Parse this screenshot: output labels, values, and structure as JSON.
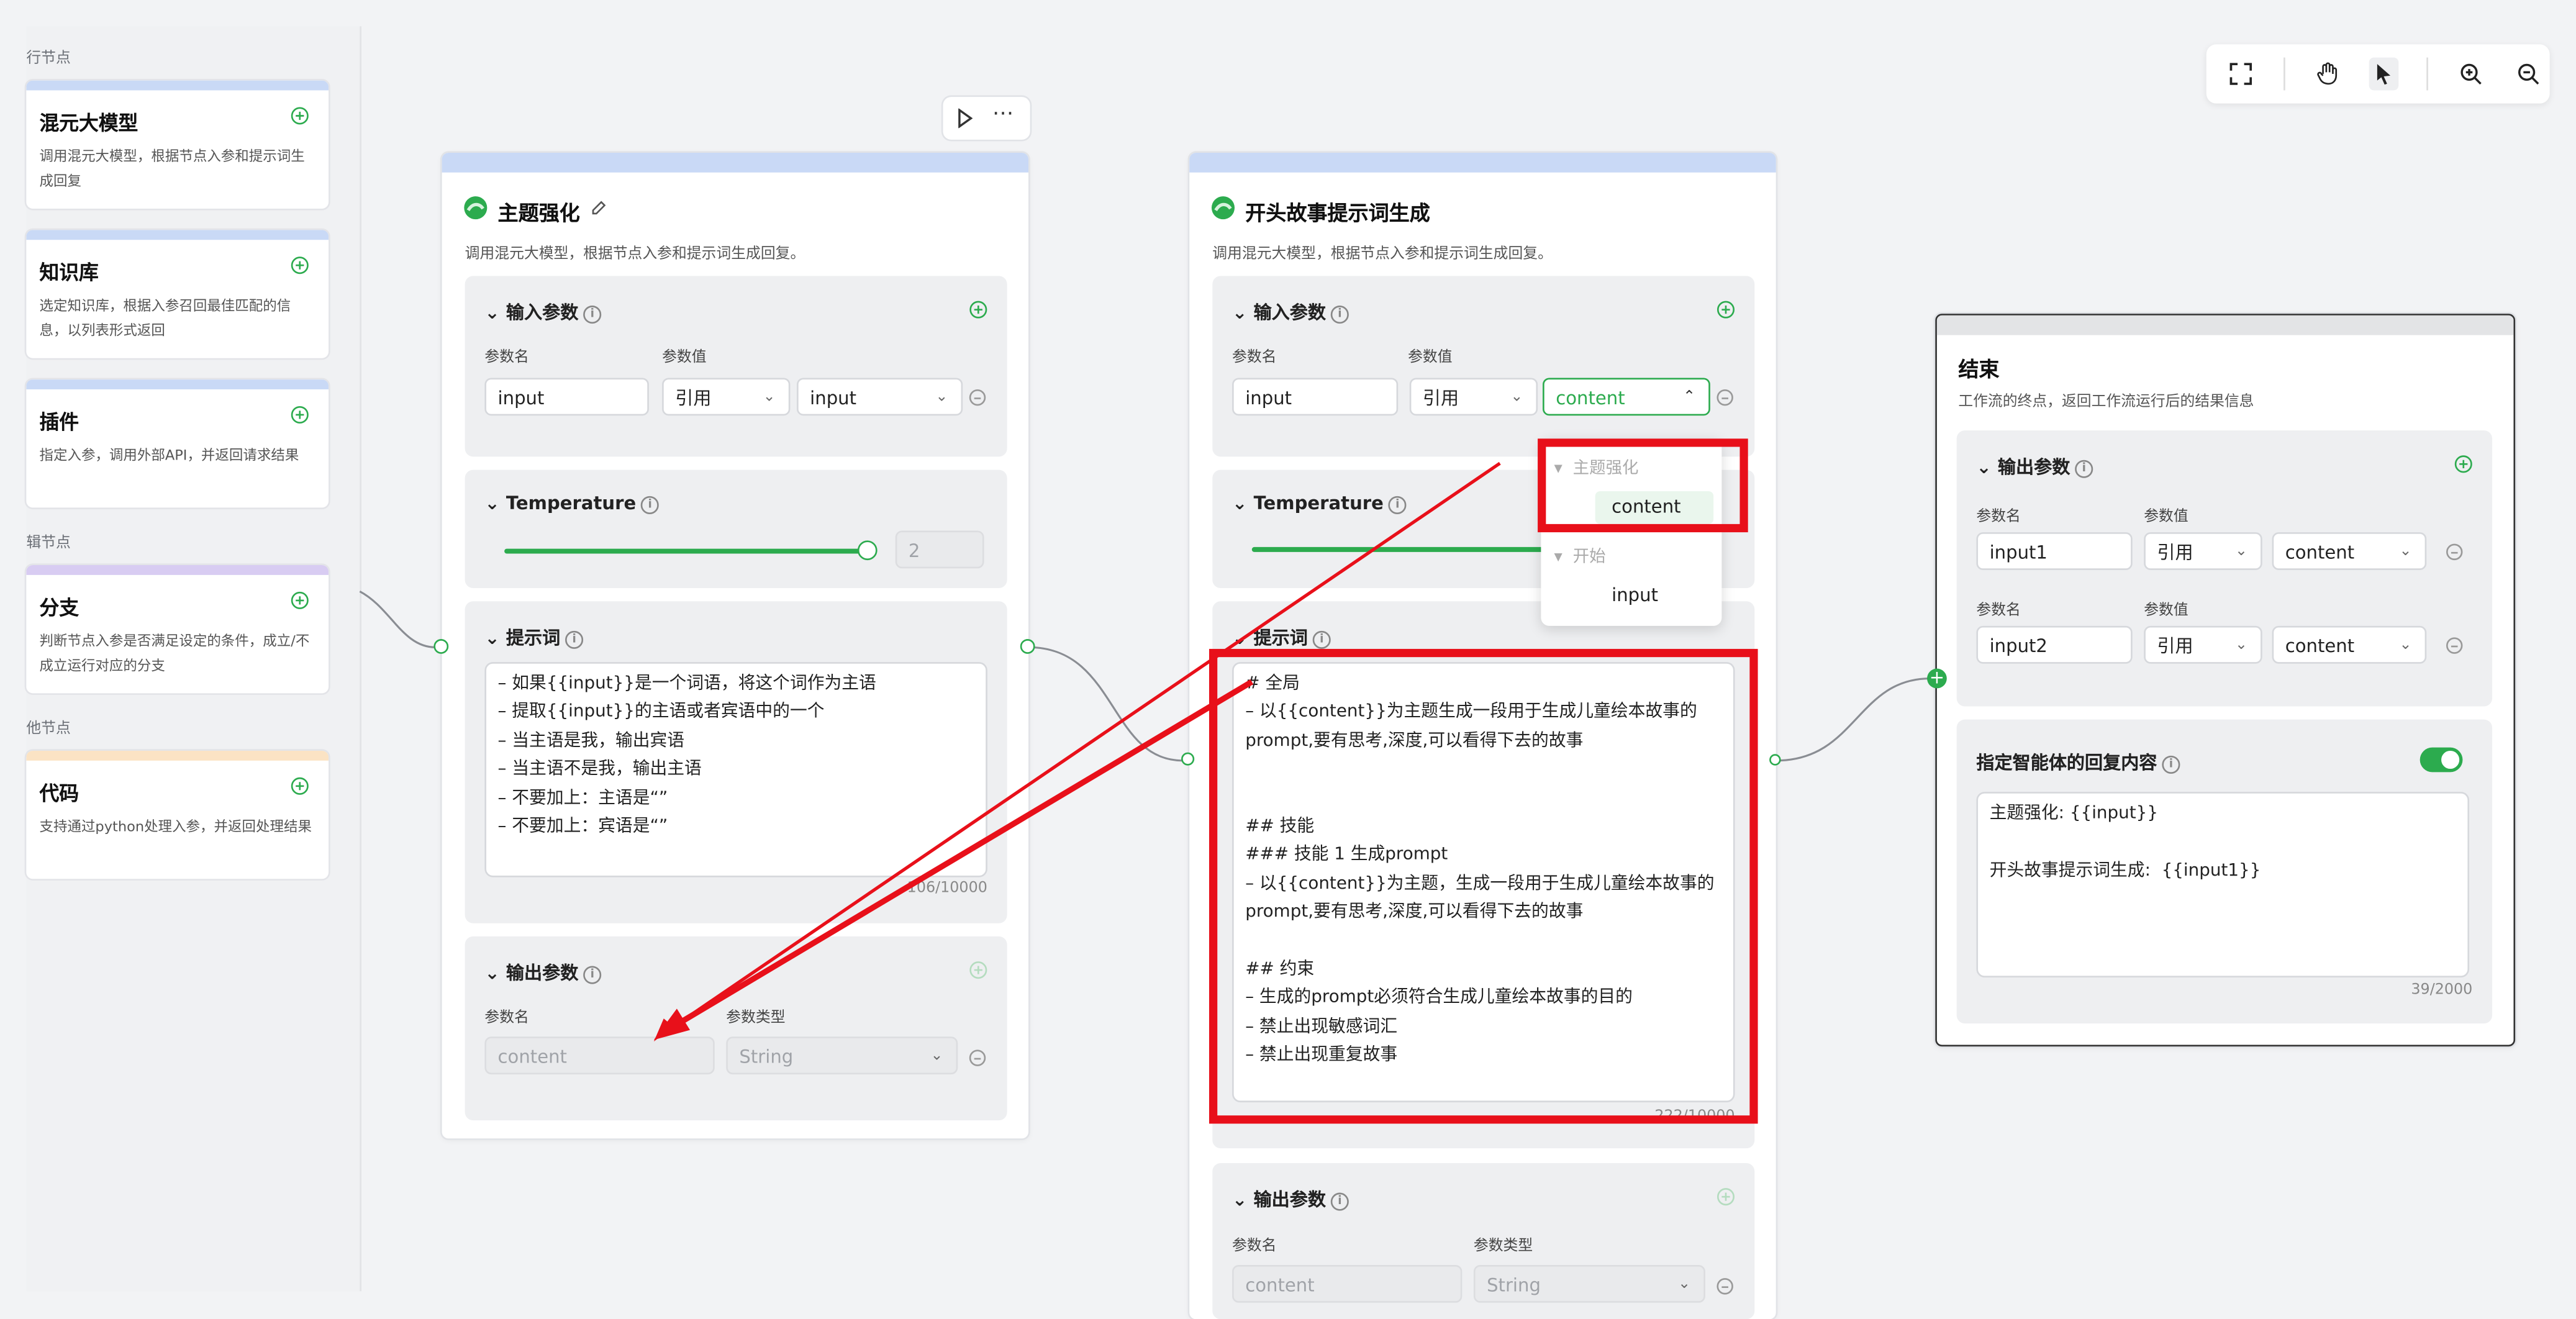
{
  "left_panel": {
    "section1": "行节点",
    "section2": "辑节点",
    "section3": "他节点",
    "cards": [
      {
        "title": "混元大模型",
        "desc": "调用混元大模型，根据节点入参和提示词生成回复",
        "color": "#c9d9f6"
      },
      {
        "title": "知识库",
        "desc": "选定知识库，根据入参召回最佳匹配的信息，以列表形式返回",
        "color": "#c9d9f6"
      },
      {
        "title": "插件",
        "desc": "指定入参，调用外部API，并返回请求结果",
        "color": "#c9d9f6"
      },
      {
        "title": "分支",
        "desc": "判断节点入参是否满足设定的条件，成立/不成立运行对应的分支",
        "color": "#d8ccf2"
      },
      {
        "title": "代码",
        "desc": "支持通过python处理入参，并返回处理结果",
        "color": "#fbe3c4"
      }
    ]
  },
  "node1": {
    "title": "主题强化",
    "desc": "调用混元大模型，根据节点入参和提示词生成回复。",
    "input_section": "输入参数",
    "param_name_label": "参数名",
    "param_value_label": "参数值",
    "param_name": "input",
    "ref_type": "引用",
    "ref_value": "input",
    "temperature_label": "Temperature",
    "temperature_value": "2",
    "temperature_level": 1.0,
    "prompt_label": "提示词",
    "prompt_lines": [
      "– 如果{{input}}是一个词语，将这个词作为主语",
      "– 提取{{input}}的主语或者宾语中的一个",
      "– 当主语是我，输出宾语",
      "– 当主语不是我，输出主语",
      "– 不要加上：主语是“”",
      "– 不要加上：宾语是“”"
    ],
    "prompt_count": "106/10000",
    "output_section": "输出参数",
    "out_name_label": "参数名",
    "out_type_label": "参数类型",
    "out_name": "content",
    "out_type": "String"
  },
  "node2": {
    "title": "开头故事提示词生成",
    "desc": "调用混元大模型，根据节点入参和提示词生成回复。",
    "input_section": "输入参数",
    "param_name_label": "参数名",
    "param_value_label": "参数值",
    "param_name": "input",
    "ref_type": "引用",
    "ref_value": "content",
    "temperature_label": "Temperature",
    "prompt_label": "提示词",
    "prompt_lines": [
      "# 全局",
      "– 以{{content}}为主题生成一段用于生成儿童绘本故事的",
      "prompt,要有思考,深度,可以看得下去的故事",
      "",
      "",
      "## 技能",
      "### 技能 1 生成prompt",
      "– 以{{content}}为主题，生成一段用于生成儿童绘本故事的",
      "prompt,要有思考,深度,可以看得下去的故事",
      "",
      "## 约束",
      "– 生成的prompt必须符合生成儿童绘本故事的目的",
      "– 禁止出现敏感词汇",
      "– 禁止出现重复故事"
    ],
    "prompt_count": "222/10000",
    "output_section": "输出参数",
    "out_name_label": "参数名",
    "out_type_label": "参数类型",
    "out_name": "content",
    "out_type": "String"
  },
  "dropdown": {
    "group1": "主题强化",
    "item1": "content",
    "group2": "开始",
    "item2": "input"
  },
  "node3": {
    "title": "结束",
    "desc": "工作流的终点，返回工作流运行后的结果信息",
    "output_section": "输出参数",
    "rows": [
      {
        "name_label": "参数名",
        "value_label": "参数值",
        "name": "input1",
        "ref_type": "引用",
        "ref_value": "content"
      },
      {
        "name_label": "参数名",
        "value_label": "参数值",
        "name": "input2",
        "ref_type": "引用",
        "ref_value": "content"
      }
    ],
    "reply_label": "指定智能体的回复内容",
    "reply_toggle": true,
    "reply_lines": [
      "主题强化: {{input}}",
      "",
      "开头故事提示词生成:  {{input1}}"
    ],
    "reply_count": "39/2000"
  },
  "toolbar": {
    "icons": [
      "fullscreen-icon",
      "hand-icon",
      "pointer-icon",
      "zoom-in-icon",
      "zoom-out-icon"
    ]
  },
  "colors": {
    "accent": "#2cab4e",
    "annotation": "#e8101a",
    "topbar": "#c9d9f6"
  }
}
